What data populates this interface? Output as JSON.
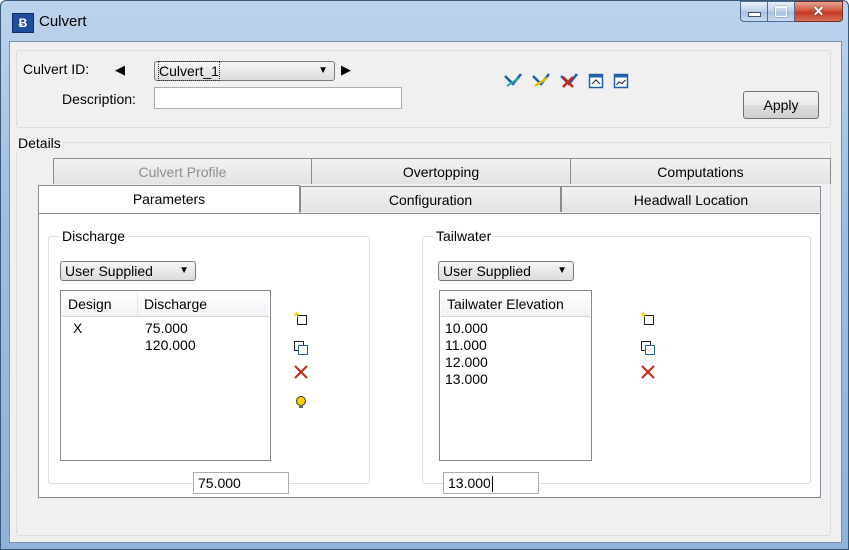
{
  "window": {
    "title": "Culvert",
    "app_icon_glyph": "Ƀ",
    "close_glyph": "✕"
  },
  "header": {
    "culvert_id_label": "Culvert ID:",
    "culvert_id_value": "Culvert_1",
    "description_label": "Description:",
    "description_value": "",
    "apply_label": "Apply",
    "prev_arrow": "◀",
    "next_arrow": "▶",
    "dropdown_arrow": "▼"
  },
  "details": {
    "label": "Details",
    "tabs_row1": [
      {
        "label": "Culvert Profile",
        "disabled": true
      },
      {
        "label": "Overtopping",
        "disabled": false
      },
      {
        "label": "Computations",
        "disabled": false
      }
    ],
    "tabs_row2": [
      {
        "label": "Parameters",
        "active": true
      },
      {
        "label": "Configuration",
        "active": false
      },
      {
        "label": "Headwall Location",
        "active": false
      }
    ]
  },
  "discharge": {
    "caption": "Discharge",
    "mode": "User Supplied",
    "columns": [
      "Design",
      "Discharge"
    ],
    "rows": [
      {
        "design": "X",
        "discharge": "75.000"
      },
      {
        "design": "",
        "discharge": "120.000"
      }
    ],
    "edit_value": "75.000"
  },
  "tailwater": {
    "caption": "Tailwater",
    "mode": "User Supplied",
    "columns": [
      "Tailwater Elevation"
    ],
    "rows": [
      "10.000",
      "11.000",
      "12.000",
      "13.000"
    ],
    "edit_value": "13.000"
  },
  "colors": {
    "delete_icon": "#c0281b",
    "bulb_icon": "#e8c800",
    "toolbar_icon_blue": "#1f5fae",
    "toolbar_icon_red": "#c0281b"
  }
}
